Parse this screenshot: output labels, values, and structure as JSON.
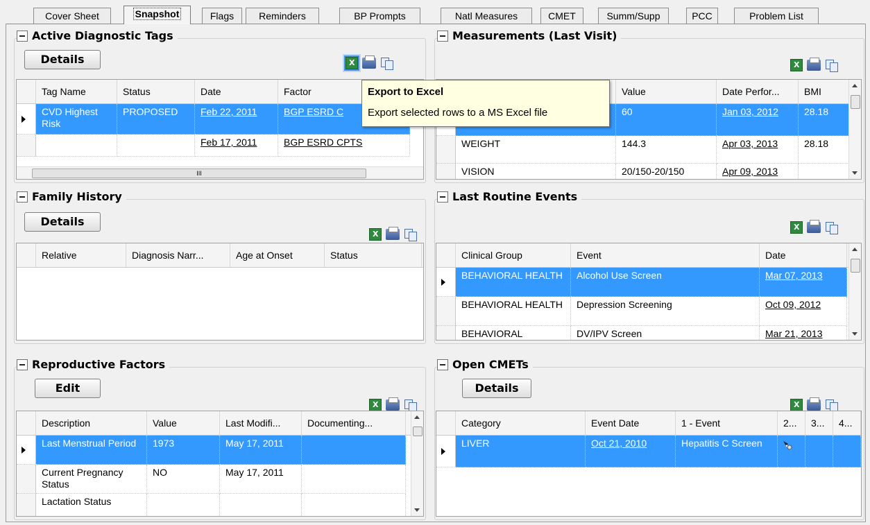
{
  "tabs": [
    "Cover Sheet",
    "Snapshot",
    "Flags",
    "Reminders",
    "BP Prompts",
    "Natl Measures",
    "CMET",
    "Summ/Supp",
    "PCC",
    "Problem List"
  ],
  "active_tab": "Snapshot",
  "tooltip": {
    "title": "Export to Excel",
    "body": "Export selected rows to a MS Excel file"
  },
  "adt": {
    "title": "Active Diagnostic Tags",
    "button": "Details",
    "columns": [
      "Tag Name",
      "Status",
      "Date",
      "Factor"
    ],
    "rows": [
      {
        "tag": "CVD Highest Risk",
        "status": "PROPOSED",
        "date": "Feb 22, 2011",
        "factor": "BGP ESRD C"
      },
      {
        "tag": "",
        "status": "",
        "date": "Feb 17, 2011",
        "factor": "BGP ESRD CPTS"
      }
    ],
    "hscroll_marker": "III"
  },
  "meas": {
    "title": "Measurements (Last Visit)",
    "columns": [
      "Value",
      "Date Perfor...",
      "BMI"
    ],
    "rows": [
      {
        "name": "",
        "value": "60",
        "date": "Jan 03, 2012",
        "bmi": "28.18"
      },
      {
        "name": "WEIGHT",
        "value": "144.3",
        "date": "Apr 03, 2013",
        "bmi": "28.18"
      },
      {
        "name": "VISION",
        "value": "20/150-20/150",
        "date": "Apr 09, 2013",
        "bmi": ""
      }
    ]
  },
  "fam": {
    "title": "Family History",
    "button": "Details",
    "columns": [
      "Relative",
      "Diagnosis Narr...",
      "Age at Onset",
      "Status"
    ]
  },
  "lre": {
    "title": "Last Routine Events",
    "columns": [
      "Clinical Group",
      "Event",
      "Date"
    ],
    "rows": [
      {
        "group": "BEHAVIORAL HEALTH",
        "event": "Alcohol Use Screen",
        "date": "Mar 07, 2013"
      },
      {
        "group": "BEHAVIORAL HEALTH",
        "event": "Depression Screening",
        "date": "Oct 09, 2012"
      },
      {
        "group": "BEHAVIORAL",
        "event": "DV/IPV Screen",
        "date": "Mar 21, 2013"
      }
    ]
  },
  "repro": {
    "title": "Reproductive Factors",
    "button": "Edit",
    "columns": [
      "Description",
      "Value",
      "Last Modifi...",
      "Documenting..."
    ],
    "rows": [
      {
        "desc": "Last Menstrual Period",
        "value": "1973",
        "mod": "May 17, 2011",
        "doc": ""
      },
      {
        "desc": "Current Pregnancy Status",
        "value": "NO",
        "mod": "May 17, 2011",
        "doc": ""
      },
      {
        "desc": "Lactation Status",
        "value": "",
        "mod": "",
        "doc": ""
      }
    ]
  },
  "cmet": {
    "title": "Open CMETs",
    "button": "Details",
    "columns": [
      "Category",
      "Event Date",
      "1 - Event",
      "2...",
      "3...",
      "4..."
    ],
    "rows": [
      {
        "cat": "LIVER",
        "date": "Oct 21, 2010",
        "event": "Hepatitis C Screen"
      }
    ]
  }
}
